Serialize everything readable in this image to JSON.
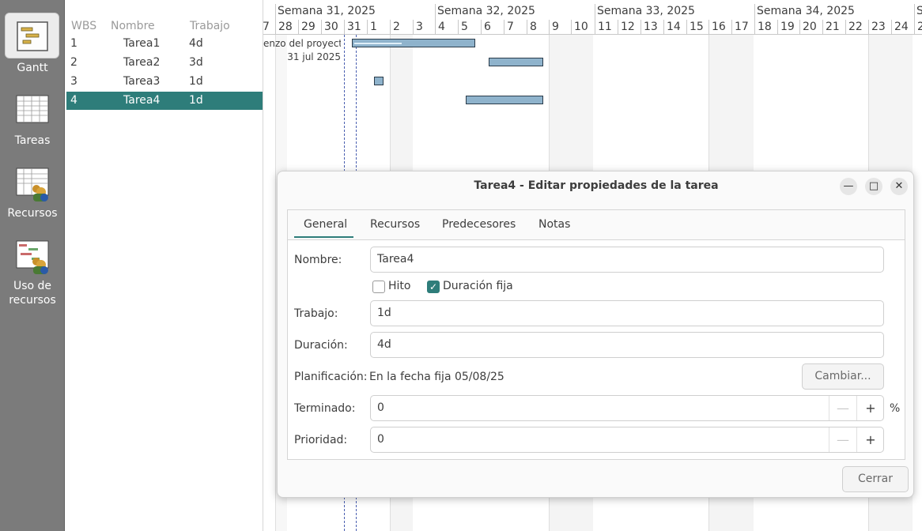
{
  "sidebar": {
    "items": [
      {
        "label": "Gantt",
        "icon": "gantt-icon",
        "active": true
      },
      {
        "label": "Tareas",
        "icon": "tasks-icon",
        "active": false
      },
      {
        "label": "Recursos",
        "icon": "resources-icon",
        "active": false
      },
      {
        "label": "Uso de recursos",
        "line1": "Uso de",
        "line2": "recursos",
        "icon": "resource-usage-icon",
        "active": false
      }
    ]
  },
  "tasklist": {
    "headers": {
      "wbs": "WBS",
      "name": "Nombre",
      "work": "Trabajo"
    },
    "rows": [
      {
        "wbs": "1",
        "name": "Tarea1",
        "work": "4d"
      },
      {
        "wbs": "2",
        "name": "Tarea2",
        "work": "3d"
      },
      {
        "wbs": "3",
        "name": "Tarea3",
        "work": "1d"
      },
      {
        "wbs": "4",
        "name": "Tarea4",
        "work": "1d"
      }
    ]
  },
  "gantt": {
    "weeks": [
      "Semana 31, 2025",
      "Semana 32, 2025",
      "Semana 33, 2025",
      "Semana 34, 2025",
      "S"
    ],
    "days": [
      "7",
      "28",
      "29",
      "30",
      "31",
      "1",
      "2",
      "3",
      "4",
      "5",
      "6",
      "7",
      "8",
      "9",
      "10",
      "11",
      "12",
      "13",
      "14",
      "15",
      "16",
      "17",
      "18",
      "19",
      "20",
      "21",
      "22",
      "23",
      "24",
      "2"
    ],
    "project_start_label": "enzo del proyecto",
    "project_start_date": "31 jul 2025"
  },
  "dialog": {
    "title": "Tarea4 - Editar propiedades de la tarea",
    "tabs": [
      "General",
      "Recursos",
      "Predecesores",
      "Notas"
    ],
    "name_label": "Nombre:",
    "name_value": "Tarea4",
    "milestone_label": "Hito",
    "fixed_duration_label": "Duración fija",
    "work_label": "Trabajo:",
    "work_value": "1d",
    "duration_label": "Duración:",
    "duration_value": "4d",
    "schedule_label": "Planificación:",
    "schedule_value": "En la fecha fija 05/08/25",
    "change_button": "Cambiar...",
    "complete_label": "Terminado:",
    "complete_value": "0",
    "percent_sign": "%",
    "priority_label": "Prioridad:",
    "priority_value": "0",
    "close_button": "Cerrar",
    "minimize_glyph": "—",
    "maximize_glyph": "□",
    "close_glyph": "✕",
    "minus_glyph": "—",
    "plus_glyph": "+",
    "check_glyph": "✓"
  }
}
